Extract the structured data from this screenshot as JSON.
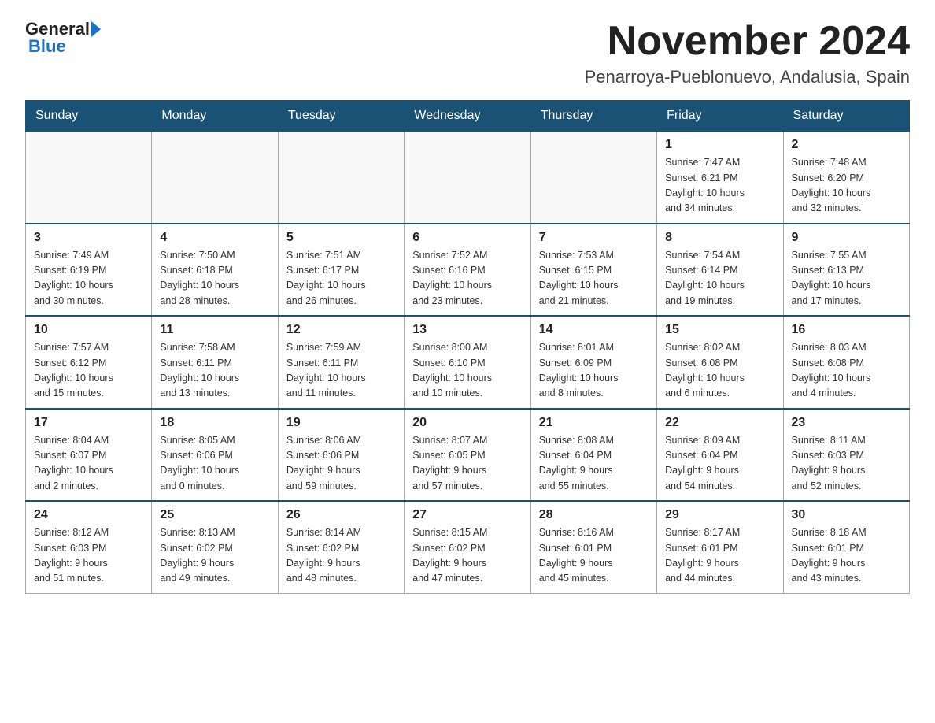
{
  "logo": {
    "general": "General",
    "blue": "Blue"
  },
  "title": "November 2024",
  "location": "Penarroya-Pueblonuevo, Andalusia, Spain",
  "days_header": [
    "Sunday",
    "Monday",
    "Tuesday",
    "Wednesday",
    "Thursday",
    "Friday",
    "Saturday"
  ],
  "weeks": [
    [
      {
        "day": "",
        "info": ""
      },
      {
        "day": "",
        "info": ""
      },
      {
        "day": "",
        "info": ""
      },
      {
        "day": "",
        "info": ""
      },
      {
        "day": "",
        "info": ""
      },
      {
        "day": "1",
        "info": "Sunrise: 7:47 AM\nSunset: 6:21 PM\nDaylight: 10 hours\nand 34 minutes."
      },
      {
        "day": "2",
        "info": "Sunrise: 7:48 AM\nSunset: 6:20 PM\nDaylight: 10 hours\nand 32 minutes."
      }
    ],
    [
      {
        "day": "3",
        "info": "Sunrise: 7:49 AM\nSunset: 6:19 PM\nDaylight: 10 hours\nand 30 minutes."
      },
      {
        "day": "4",
        "info": "Sunrise: 7:50 AM\nSunset: 6:18 PM\nDaylight: 10 hours\nand 28 minutes."
      },
      {
        "day": "5",
        "info": "Sunrise: 7:51 AM\nSunset: 6:17 PM\nDaylight: 10 hours\nand 26 minutes."
      },
      {
        "day": "6",
        "info": "Sunrise: 7:52 AM\nSunset: 6:16 PM\nDaylight: 10 hours\nand 23 minutes."
      },
      {
        "day": "7",
        "info": "Sunrise: 7:53 AM\nSunset: 6:15 PM\nDaylight: 10 hours\nand 21 minutes."
      },
      {
        "day": "8",
        "info": "Sunrise: 7:54 AM\nSunset: 6:14 PM\nDaylight: 10 hours\nand 19 minutes."
      },
      {
        "day": "9",
        "info": "Sunrise: 7:55 AM\nSunset: 6:13 PM\nDaylight: 10 hours\nand 17 minutes."
      }
    ],
    [
      {
        "day": "10",
        "info": "Sunrise: 7:57 AM\nSunset: 6:12 PM\nDaylight: 10 hours\nand 15 minutes."
      },
      {
        "day": "11",
        "info": "Sunrise: 7:58 AM\nSunset: 6:11 PM\nDaylight: 10 hours\nand 13 minutes."
      },
      {
        "day": "12",
        "info": "Sunrise: 7:59 AM\nSunset: 6:11 PM\nDaylight: 10 hours\nand 11 minutes."
      },
      {
        "day": "13",
        "info": "Sunrise: 8:00 AM\nSunset: 6:10 PM\nDaylight: 10 hours\nand 10 minutes."
      },
      {
        "day": "14",
        "info": "Sunrise: 8:01 AM\nSunset: 6:09 PM\nDaylight: 10 hours\nand 8 minutes."
      },
      {
        "day": "15",
        "info": "Sunrise: 8:02 AM\nSunset: 6:08 PM\nDaylight: 10 hours\nand 6 minutes."
      },
      {
        "day": "16",
        "info": "Sunrise: 8:03 AM\nSunset: 6:08 PM\nDaylight: 10 hours\nand 4 minutes."
      }
    ],
    [
      {
        "day": "17",
        "info": "Sunrise: 8:04 AM\nSunset: 6:07 PM\nDaylight: 10 hours\nand 2 minutes."
      },
      {
        "day": "18",
        "info": "Sunrise: 8:05 AM\nSunset: 6:06 PM\nDaylight: 10 hours\nand 0 minutes."
      },
      {
        "day": "19",
        "info": "Sunrise: 8:06 AM\nSunset: 6:06 PM\nDaylight: 9 hours\nand 59 minutes."
      },
      {
        "day": "20",
        "info": "Sunrise: 8:07 AM\nSunset: 6:05 PM\nDaylight: 9 hours\nand 57 minutes."
      },
      {
        "day": "21",
        "info": "Sunrise: 8:08 AM\nSunset: 6:04 PM\nDaylight: 9 hours\nand 55 minutes."
      },
      {
        "day": "22",
        "info": "Sunrise: 8:09 AM\nSunset: 6:04 PM\nDaylight: 9 hours\nand 54 minutes."
      },
      {
        "day": "23",
        "info": "Sunrise: 8:11 AM\nSunset: 6:03 PM\nDaylight: 9 hours\nand 52 minutes."
      }
    ],
    [
      {
        "day": "24",
        "info": "Sunrise: 8:12 AM\nSunset: 6:03 PM\nDaylight: 9 hours\nand 51 minutes."
      },
      {
        "day": "25",
        "info": "Sunrise: 8:13 AM\nSunset: 6:02 PM\nDaylight: 9 hours\nand 49 minutes."
      },
      {
        "day": "26",
        "info": "Sunrise: 8:14 AM\nSunset: 6:02 PM\nDaylight: 9 hours\nand 48 minutes."
      },
      {
        "day": "27",
        "info": "Sunrise: 8:15 AM\nSunset: 6:02 PM\nDaylight: 9 hours\nand 47 minutes."
      },
      {
        "day": "28",
        "info": "Sunrise: 8:16 AM\nSunset: 6:01 PM\nDaylight: 9 hours\nand 45 minutes."
      },
      {
        "day": "29",
        "info": "Sunrise: 8:17 AM\nSunset: 6:01 PM\nDaylight: 9 hours\nand 44 minutes."
      },
      {
        "day": "30",
        "info": "Sunrise: 8:18 AM\nSunset: 6:01 PM\nDaylight: 9 hours\nand 43 minutes."
      }
    ]
  ]
}
